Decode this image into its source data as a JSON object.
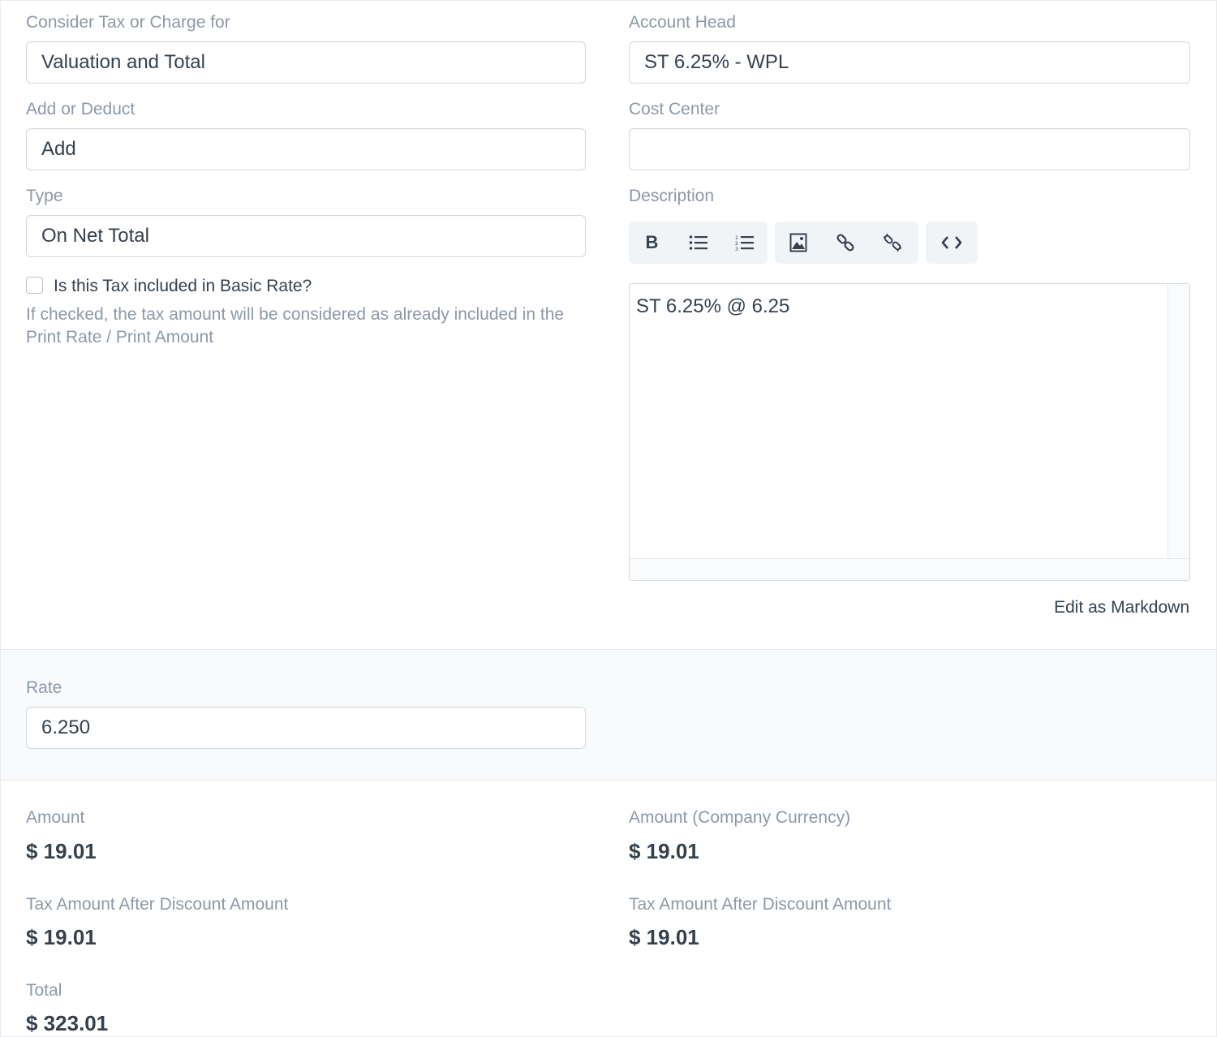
{
  "left": {
    "consider_tax": {
      "label": "Consider Tax or Charge for",
      "value": "Valuation and Total"
    },
    "add_or_deduct": {
      "label": "Add or Deduct",
      "value": "Add"
    },
    "type": {
      "label": "Type",
      "value": "On Net Total"
    },
    "included_checkbox": {
      "label": "Is this Tax included in Basic Rate?",
      "checked": false,
      "help": "If checked, the tax amount will be considered as already included in the Print Rate / Print Amount"
    }
  },
  "right": {
    "account_head": {
      "label": "Account Head",
      "value": "ST 6.25% - WPL"
    },
    "cost_center": {
      "label": "Cost Center",
      "value": ""
    },
    "description": {
      "label": "Description",
      "content": "ST 6.25% @ 6.25",
      "edit_markdown": "Edit as Markdown",
      "toolbar": [
        "bold-icon",
        "bullet-list-icon",
        "numbered-list-icon",
        "image-icon",
        "link-icon",
        "unlink-icon",
        "code-view-icon"
      ]
    }
  },
  "rate": {
    "label": "Rate",
    "value": "6.250"
  },
  "amounts": {
    "amount": {
      "label": "Amount",
      "value": "$ 19.01"
    },
    "amount_company": {
      "label": "Amount (Company Currency)",
      "value": "$ 19.01"
    },
    "tax_after_discount": {
      "label": "Tax Amount After Discount Amount",
      "value": "$ 19.01"
    },
    "tax_after_discount_company": {
      "label": "Tax Amount After Discount Amount",
      "value": "$ 19.01"
    },
    "total": {
      "label": "Total",
      "value": "$ 323.01"
    }
  },
  "colors": {
    "label": "#8d99a6",
    "text": "#36414c",
    "border": "#d1d8dd",
    "toolbar_bg": "#f0f4f7",
    "band_bg": "#f9fafb"
  }
}
